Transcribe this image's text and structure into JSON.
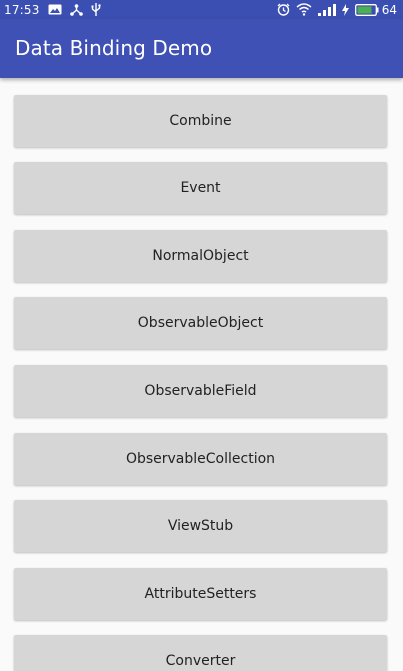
{
  "status_bar": {
    "time": "17:53",
    "battery_percent": "64",
    "icons_left": [
      "gallery-icon",
      "share-icon",
      "usb-icon"
    ],
    "icons_right": [
      "alarm-icon",
      "wifi-icon",
      "signal-icon",
      "charging-icon",
      "battery-icon"
    ]
  },
  "app_bar": {
    "title": "Data Binding Demo",
    "color": "#3f51b5"
  },
  "buttons": [
    {
      "label": "Combine"
    },
    {
      "label": "Event"
    },
    {
      "label": "NormalObject"
    },
    {
      "label": "ObservableObject"
    },
    {
      "label": "ObservableField"
    },
    {
      "label": "ObservableCollection"
    },
    {
      "label": "ViewStub"
    },
    {
      "label": "AttributeSetters"
    },
    {
      "label": "Converter"
    }
  ]
}
